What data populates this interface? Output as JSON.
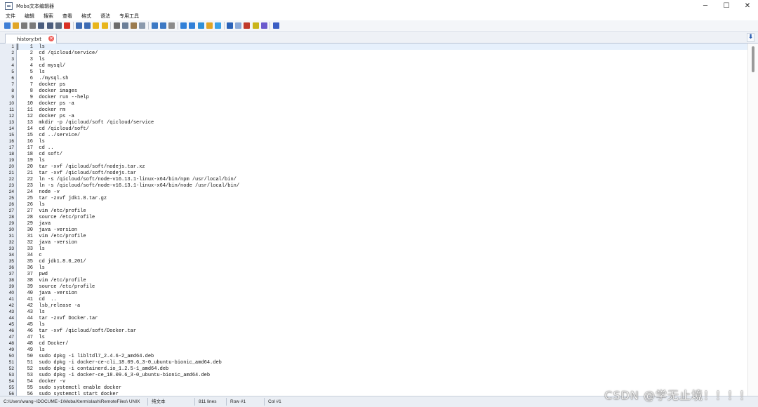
{
  "window": {
    "title": "Moba文本编辑器",
    "controls": {
      "minimize": "─",
      "maximize": "☐",
      "close": "✕"
    }
  },
  "menu": [
    "文件",
    "编辑",
    "搜索",
    "查看",
    "格式",
    "语法",
    "专用工具"
  ],
  "toolbar": {
    "icons": [
      {
        "name": "new-file-icon",
        "color": "#3f7fd6"
      },
      {
        "name": "open-folder-icon",
        "color": "#e0a526"
      },
      {
        "name": "reload-icon",
        "color": "#7a7a7a"
      },
      {
        "name": "stop-icon",
        "color": "#7a7a7a"
      },
      {
        "name": "save-icon",
        "color": "#4a5d7e"
      },
      {
        "name": "save-all-icon",
        "color": "#4a5d7e"
      },
      {
        "name": "print-icon",
        "color": "#5b6a80"
      },
      {
        "name": "close-doc-icon",
        "color": "#d93025"
      },
      {
        "sep": true
      },
      {
        "name": "indent-icon",
        "color": "#3c6bb4"
      },
      {
        "name": "outdent-icon",
        "color": "#3c6bb4"
      },
      {
        "name": "bookmark-icon",
        "color": "#e8b51c"
      },
      {
        "name": "bookmark-next-icon",
        "color": "#e8b51c"
      },
      {
        "sep": true
      },
      {
        "name": "cut-icon",
        "color": "#6b6b6b"
      },
      {
        "name": "copy-icon",
        "color": "#6b7f99"
      },
      {
        "name": "paste-icon",
        "color": "#9a7b4f"
      },
      {
        "name": "delete-icon",
        "color": "#8b9aad"
      },
      {
        "sep": true
      },
      {
        "name": "search-icon",
        "color": "#3b78c4"
      },
      {
        "name": "replace-icon",
        "color": "#3b78c4"
      },
      {
        "name": "goto-line-icon",
        "color": "#8a8a8a"
      },
      {
        "sep": true
      },
      {
        "name": "compare-icon",
        "color": "#2f7fd8"
      },
      {
        "name": "sync-icon",
        "color": "#2f7fd8"
      },
      {
        "name": "windows-icon",
        "color": "#2f8fd8"
      },
      {
        "name": "linux-icon",
        "color": "#e0a526"
      },
      {
        "name": "mac-icon",
        "color": "#3aa0e8"
      },
      {
        "sep": true
      },
      {
        "name": "undo-icon",
        "color": "#2a62b8"
      },
      {
        "name": "redo-icon",
        "color": "#8aa9d8"
      },
      {
        "name": "paragraph-icon",
        "color": "#c0392b"
      },
      {
        "name": "highlight-icon",
        "color": "#c9b41b"
      },
      {
        "name": "macro-icon",
        "color": "#6a5acd"
      },
      {
        "sep": true
      },
      {
        "name": "exit-icon",
        "color": "#3b5ec4"
      }
    ]
  },
  "tab": {
    "label": "history.txt",
    "close": "✕",
    "dropdown": "⬇"
  },
  "editor": {
    "lines": [
      "    1  ls",
      "    2  cd /qicloud/service/",
      "    3  ls",
      "    4  cd mysql/",
      "    5  ls",
      "    6  ./mysql.sh",
      "    7  docker ps",
      "    8  docker images",
      "    9  docker run --help",
      "   10  docker ps -a",
      "   11  docker rm",
      "   12  docker ps -a",
      "   13  mkdir -p /qicloud/soft /qicloud/service",
      "   14  cd /qicloud/soft/",
      "   15  cd ../service/",
      "   16  ls",
      "   17  cd ..",
      "   18  cd soft/",
      "   19  ls",
      "   20  tar -xvf /qicloud/soft/nodejs.tar.xz",
      "   21  tar -xvf /qicloud/soft/nodejs.tar",
      "   22  ln -s /qicloud/soft/node-v16.13.1-linux-x64/bin/npm /usr/local/bin/",
      "   23  ln -s /qicloud/soft/node-v16.13.1-linux-x64/bin/node /usr/local/bin/",
      "   24  node -v",
      "   25  tar -zxvf jdk1.8.tar.gz",
      "   26  ls",
      "   27  vim /etc/profile",
      "   28  source /etc/profile",
      "   29  java",
      "   30  java -version",
      "   31  vim /etc/profile",
      "   32  java -version",
      "   33  ls",
      "   34  c",
      "   35  cd jdk1.8.0_201/",
      "   36  ls",
      "   37  pwd",
      "   38  vim /etc/profile",
      "   39  source /etc/profile",
      "   40  java -version",
      "   41  cd  ..",
      "   42  lsb_release -a",
      "   43  ls",
      "   44  tar -zxvf Docker.tar",
      "   45  ls",
      "   46  tar -xvf /qicloud/soft/Docker.tar",
      "   47  ls",
      "   48  cd Docker/",
      "   49  ls",
      "   50  sudo dpkg -i libltdl7_2.4.6-2_amd64.deb",
      "   51  sudo dpkg -i docker-ce-cli_18.09.6_3-0_ubuntu-bionic_amd64.deb",
      "   52  sudo dpkg -i containerd.io_1.2.5-1_amd64.deb",
      "   53  sudo dpkg -i docker-ce_18.09.6_3-0_ubuntu-bionic_amd64.deb",
      "   54  docker -v",
      "   55  sudo systemctl enable docker",
      "   56  sudo systemctl start docker"
    ]
  },
  "status": {
    "path": "C:\\Users\\wang~\\DOCUME~1\\MobaXterm\\slash\\RemoteFiles\\",
    "eol": "UNIX",
    "encoding": "纯文本",
    "lines_count": "811 lines",
    "row": "Row #1",
    "col": "Col #1"
  },
  "watermark": "CSDN @学无止境！！！！"
}
